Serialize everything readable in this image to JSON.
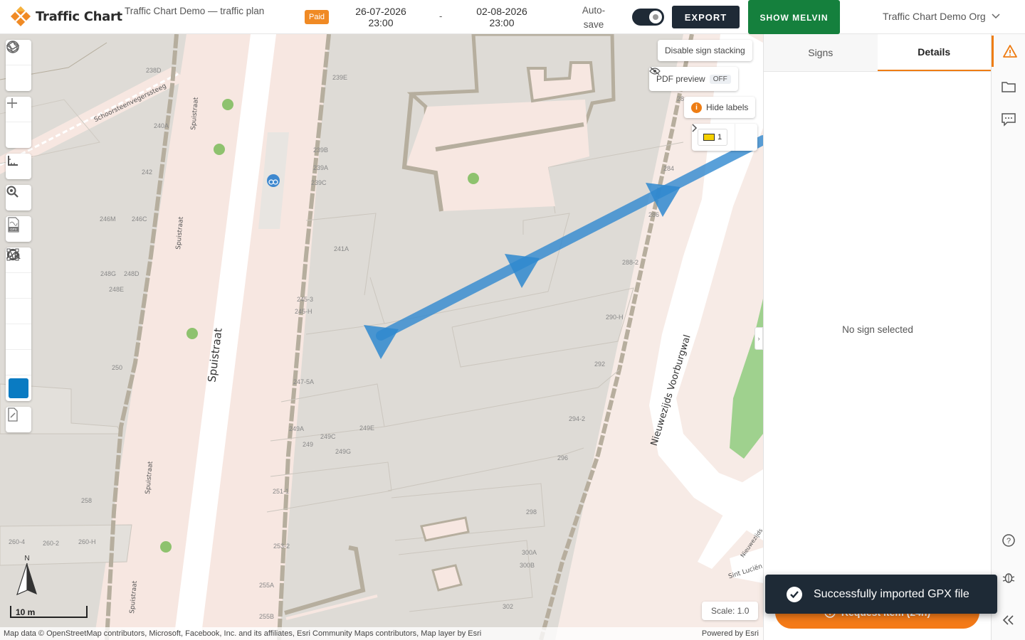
{
  "app": {
    "logo_text": "Traffic Chart",
    "plan_title": "Traffic Chart Demo — traffic plan",
    "paid_badge": "Paid",
    "start_date": "26-07-2026",
    "start_time": "23:00",
    "date_separator": "-",
    "end_date": "02-08-2026",
    "end_time": "23:00",
    "autosave_label": "Auto-save",
    "autosave_on": true,
    "export_label": "EXPORT",
    "melvin_label": "SHOW MELVIN",
    "org_name": "Traffic Chart Demo Org"
  },
  "map": {
    "controls": {
      "disable_stacking": "Disable sign stacking",
      "pdf_preview": "PDF preview",
      "pdf_preview_state": "OFF",
      "hide_labels": "Hide labels",
      "info_glyph": "i",
      "sign_count": "1",
      "scale": "Scale: 1.0"
    },
    "scalebar_label": "10 m",
    "north_label": "N",
    "attribution": "Map data © OpenStreetMap contributors, Microsoft, Facebook, Inc. and its affiliates, Esri Community Maps contributors, Map layer by Esri",
    "powered_by": "Powered by Esri",
    "streets": {
      "spuistraat_main": "Spuistraat",
      "spuistraat_small": "Spuistraat",
      "schoorsteen": "Schoorsteenvegerssteeg",
      "voorburgwal": "Nieuwezijds Voorburgwal",
      "nieuwezijds_small": "Nieuwezijds",
      "sint_lucien": "Sint Luciën"
    },
    "house_numbers": {
      "n238d": "238D",
      "n239e": "239E",
      "n240a": "240A",
      "n242": "242",
      "n239b": "239B",
      "n239a": "239A",
      "n239c": "239C",
      "n246m": "246M",
      "n246c": "246C",
      "n241a": "241A",
      "n248g": "248G",
      "n248d": "248D",
      "n248e": "248E",
      "n245_3": "245-3",
      "n245h": "245-H",
      "n250": "250",
      "n247_5a": "247-5A",
      "n249a": "249A",
      "n249c": "249C",
      "n249e": "249E",
      "n249": "249",
      "n249g": "249G",
      "n251_1": "251-1",
      "n258": "258",
      "n260_4": "260-4",
      "n260_2": "260-2",
      "n260h": "260-H",
      "n253_2": "253-2",
      "n255a": "255A",
      "n255b": "255B",
      "n284": "284",
      "n286": "286",
      "n288_2": "288-2",
      "n290h": "290-H",
      "n292": "292",
      "n294_2": "294-2",
      "n296": "296",
      "n298": "298",
      "n300a": "300A",
      "n300b": "300B",
      "n302": "302",
      "n28x": "28"
    }
  },
  "panel": {
    "tabs": [
      {
        "label": "Signs",
        "active": false
      },
      {
        "label": "Details",
        "active": true
      }
    ],
    "empty_state": "No sign selected",
    "request_button": "Request item (24h)"
  },
  "toast": {
    "message": "Successfully imported GPX file"
  },
  "colors": {
    "accent_orange": "#ee7d14",
    "route_blue": "#2f88cf",
    "dark": "#1f2a36",
    "green_button": "#15803d"
  },
  "icons": {
    "left_toolbar": [
      "globe-icon",
      "layers-icon",
      "zoom-in-icon",
      "zoom-out-icon",
      "measure-icon",
      "search-zoom-icon",
      "gpx-file-icon",
      "line-tool-icon",
      "rectangle-tool-icon",
      "circle-tool-icon",
      "polygon-tool-icon",
      "text-tool-icon",
      "color-swatch",
      "edit-document-icon"
    ],
    "rail": [
      "warning-icon",
      "folder-icon",
      "comment-icon",
      "help-icon",
      "bug-icon",
      "collapse-icon"
    ]
  }
}
